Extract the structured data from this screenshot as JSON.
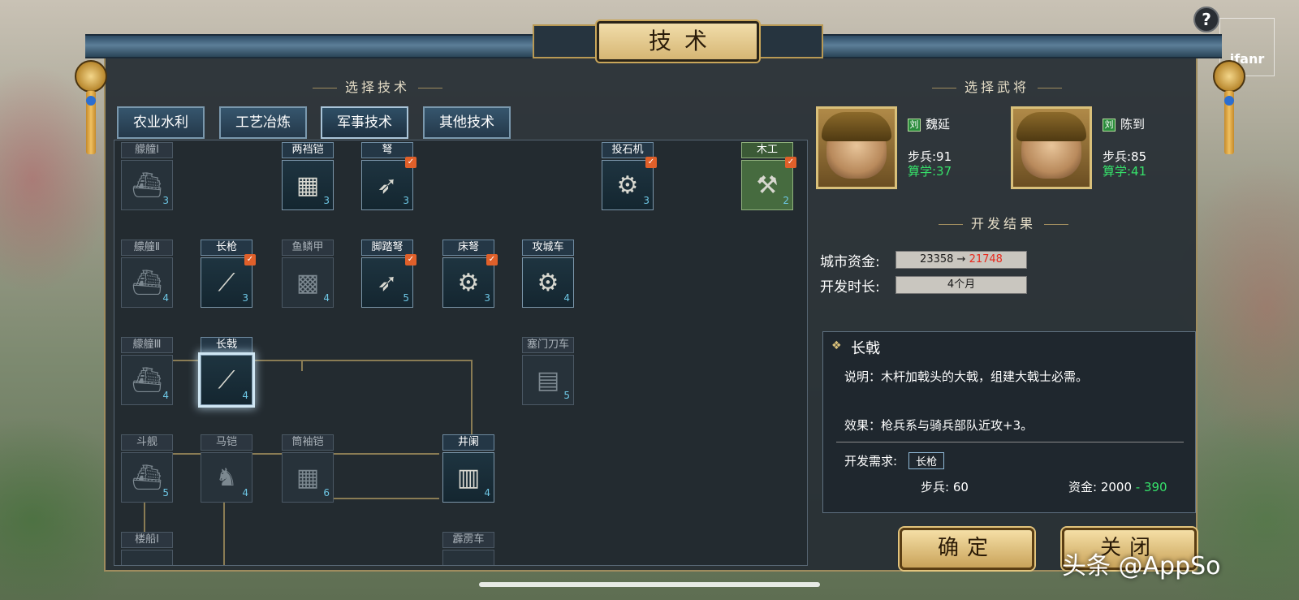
{
  "title": "技术",
  "help": "?",
  "watermark_top": "ifanr",
  "section_select_tech": "选择技术",
  "section_select_general": "选择武将",
  "section_result": "开发结果",
  "tabs": [
    "农业水利",
    "工艺冶炼",
    "军事技术",
    "其他技术"
  ],
  "active_tab": "军事技术",
  "tech_nodes": [
    {
      "id": "mengchong1",
      "label": "艨艟Ⅰ",
      "level": "3",
      "state": "dim",
      "icon": "ship-icon",
      "glyph": "⛴"
    },
    {
      "id": "liangdangkai",
      "label": "两裆铠",
      "level": "3",
      "state": "normal",
      "icon": "armor-icon",
      "glyph": "▦"
    },
    {
      "id": "nu",
      "label": "弩",
      "level": "3",
      "state": "normal",
      "check": true,
      "icon": "crossbow-icon",
      "glyph": "➶"
    },
    {
      "id": "toushiji",
      "label": "投石机",
      "level": "3",
      "state": "normal",
      "check": true,
      "icon": "catapult-icon",
      "glyph": "⚙"
    },
    {
      "id": "mugong",
      "label": "木工",
      "level": "2",
      "state": "green",
      "check": true,
      "icon": "carpentry-icon",
      "glyph": "⚒"
    },
    {
      "id": "mengchong2",
      "label": "艨艟Ⅱ",
      "level": "4",
      "state": "dim",
      "icon": "ship-icon",
      "glyph": "⛴"
    },
    {
      "id": "changqiang",
      "label": "长枪",
      "level": "3",
      "state": "normal",
      "check": true,
      "icon": "spear-icon",
      "glyph": "⟋"
    },
    {
      "id": "yulinjia",
      "label": "鱼鳞甲",
      "level": "4",
      "state": "dim",
      "icon": "scale-armor-icon",
      "glyph": "▩"
    },
    {
      "id": "jiaotanu",
      "label": "脚踏弩",
      "level": "5",
      "state": "normal",
      "check": true,
      "icon": "foot-crossbow-icon",
      "glyph": "➶"
    },
    {
      "id": "chuangnu",
      "label": "床弩",
      "level": "3",
      "state": "normal",
      "check": true,
      "icon": "bed-crossbow-icon",
      "glyph": "⚙"
    },
    {
      "id": "gongchengche",
      "label": "攻城车",
      "level": "4",
      "state": "normal",
      "icon": "siege-cart-icon",
      "glyph": "⚙"
    },
    {
      "id": "mengchong3",
      "label": "艨艟Ⅲ",
      "level": "4",
      "state": "dim",
      "icon": "ship-icon",
      "glyph": "⛴"
    },
    {
      "id": "changji",
      "label": "长戟",
      "level": "4",
      "state": "sel",
      "icon": "halberd-icon",
      "glyph": "⟋"
    },
    {
      "id": "saimendaoche",
      "label": "塞门刀车",
      "level": "5",
      "state": "dim",
      "icon": "blade-cart-icon",
      "glyph": "▤"
    },
    {
      "id": "doujian",
      "label": "斗舰",
      "level": "5",
      "state": "dim",
      "icon": "warship-icon",
      "glyph": "⛴"
    },
    {
      "id": "makai",
      "label": "马铠",
      "level": "4",
      "state": "dim",
      "icon": "horse-armor-icon",
      "glyph": "♞"
    },
    {
      "id": "tongxiukai",
      "label": "筒袖铠",
      "level": "6",
      "state": "dim",
      "icon": "sleeve-armor-icon",
      "glyph": "▦"
    },
    {
      "id": "jinglan",
      "label": "井阑",
      "level": "4",
      "state": "normal",
      "icon": "siege-tower-icon",
      "glyph": "▥"
    },
    {
      "id": "louchuan1",
      "label": "楼船Ⅰ",
      "level": "",
      "state": "dim",
      "icon": "tower-ship-icon",
      "glyph": ""
    },
    {
      "id": "pilice",
      "label": "霹雳车",
      "level": "",
      "state": "dim",
      "icon": "thunder-cart-icon",
      "glyph": ""
    }
  ],
  "generals": [
    {
      "faction": "刘",
      "name": "魏延",
      "stat1": "步兵:91",
      "stat2": "算学:37"
    },
    {
      "faction": "刘",
      "name": "陈到",
      "stat1": "步兵:85",
      "stat2": "算学:41"
    }
  ],
  "result": {
    "funds_label": "城市资金:",
    "funds_before": "23358",
    "funds_arrow": "→",
    "funds_after": "21748",
    "duration_label": "开发时长:",
    "duration": "4个月"
  },
  "detail": {
    "name": "长戟",
    "desc": "说明：木杆加戟头的大戟，组建大戟士必需。",
    "effect": "效果：枪兵系与骑兵部队近攻+3。",
    "req_label": "开发需求:",
    "req_tag": "长枪",
    "troops": "步兵: 60",
    "cost_label": "资金: 2000",
    "cost_dash": " - ",
    "cost_green": "390"
  },
  "buttons": {
    "confirm": "确定",
    "close": "关闭"
  },
  "watermark": "头条 @AppSo",
  "colors": {
    "accent_gold": "#d9c07a",
    "funds_red": "#e8281c",
    "stat_green": "#36e06a"
  }
}
